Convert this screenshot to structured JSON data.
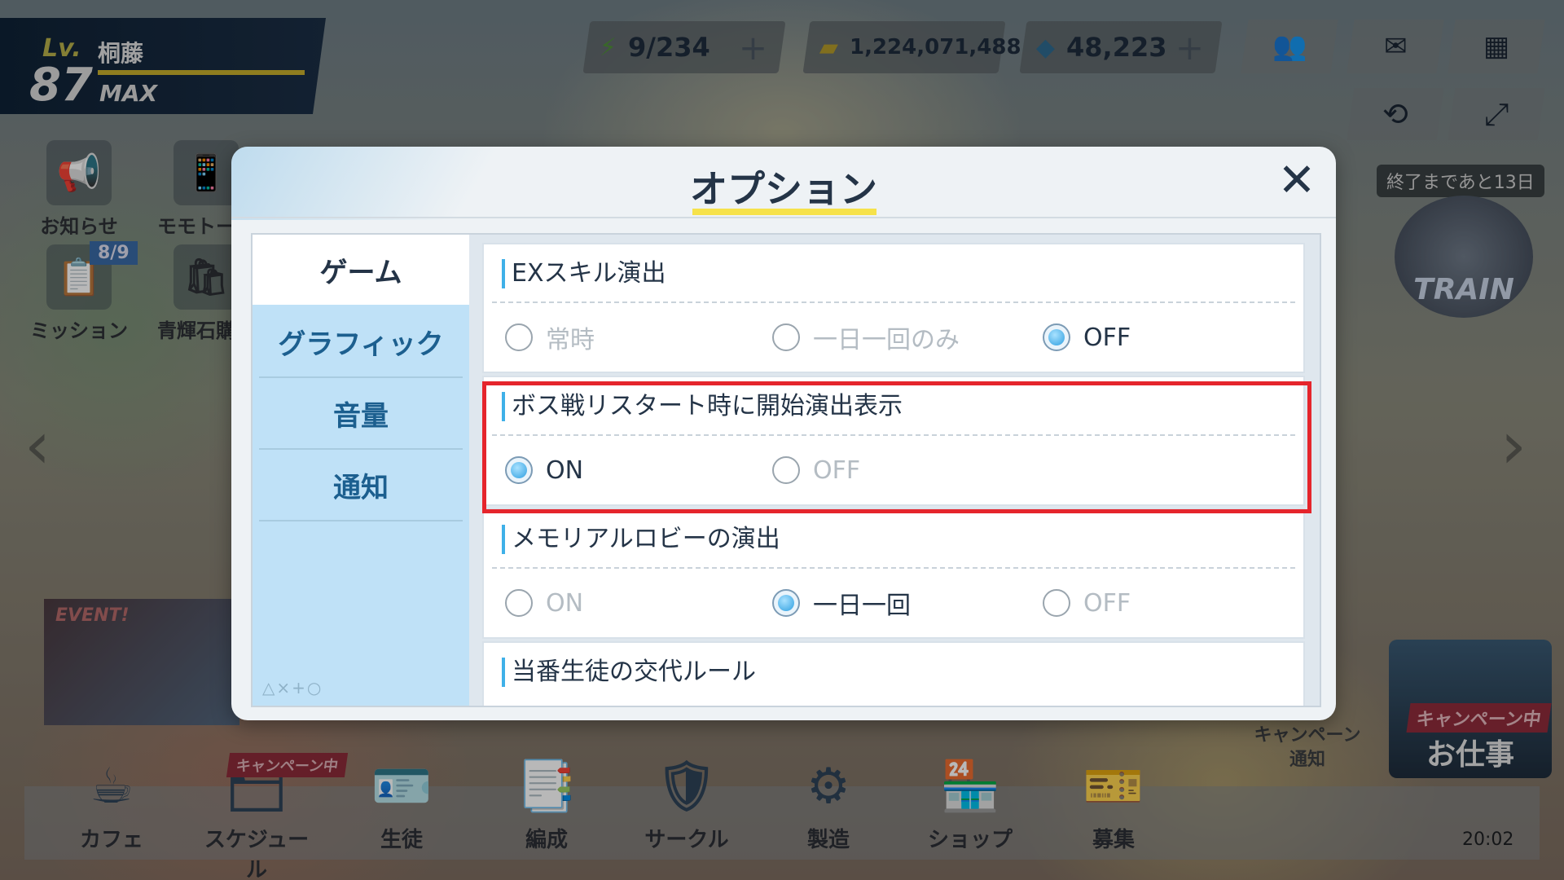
{
  "hud": {
    "level_label": "Lv.",
    "level": "87",
    "player_name": "桐藤",
    "level_state": "MAX",
    "stamina": "9/234",
    "credits": "1,224,071,488",
    "pyroxene": "48,223",
    "plus": "+"
  },
  "side_menu": {
    "notice": "お知らせ",
    "momotalk": "モモトーク",
    "mission": "ミッション",
    "mission_count": "8/9",
    "pyroxene_shop": "青輝石購入"
  },
  "event": {
    "banner_label": "EVENT!",
    "timer": "終了まであと13日",
    "train_label": "TRAIN"
  },
  "campaign": {
    "tag": "キャンペーン中",
    "title": "お仕事",
    "notice": "キャンペーン\n通知"
  },
  "bottom_nav": {
    "items": [
      "カフェ",
      "スケジュール",
      "生徒",
      "編成",
      "サークル",
      "製造",
      "ショップ",
      "募集"
    ],
    "badge": "キャンペーン中",
    "clock": "20:02"
  },
  "dialog": {
    "title": "オプション",
    "close_symbol": "✕",
    "tabs": [
      "ゲーム",
      "グラフィック",
      "音量",
      "通知"
    ],
    "active_tab": "ゲーム",
    "deco": "△×+○",
    "sections": [
      {
        "title": "EXスキル演出",
        "options": [
          "常時",
          "一日一回のみ",
          "OFF"
        ],
        "selected": "OFF"
      },
      {
        "title": "ボス戦リスタート時に開始演出表示",
        "options": [
          "ON",
          "OFF"
        ],
        "selected": "ON"
      },
      {
        "title": "メモリアルロビーの演出",
        "options": [
          "ON",
          "一日一回",
          "OFF"
        ],
        "selected": "一日一回"
      },
      {
        "title": "当番生徒の交代ルール",
        "options": [],
        "selected": ""
      }
    ]
  },
  "colors": {
    "accent_blue": "#3fb0e8",
    "highlight_red": "#e5252c",
    "title_underline": "#f6e24b"
  }
}
